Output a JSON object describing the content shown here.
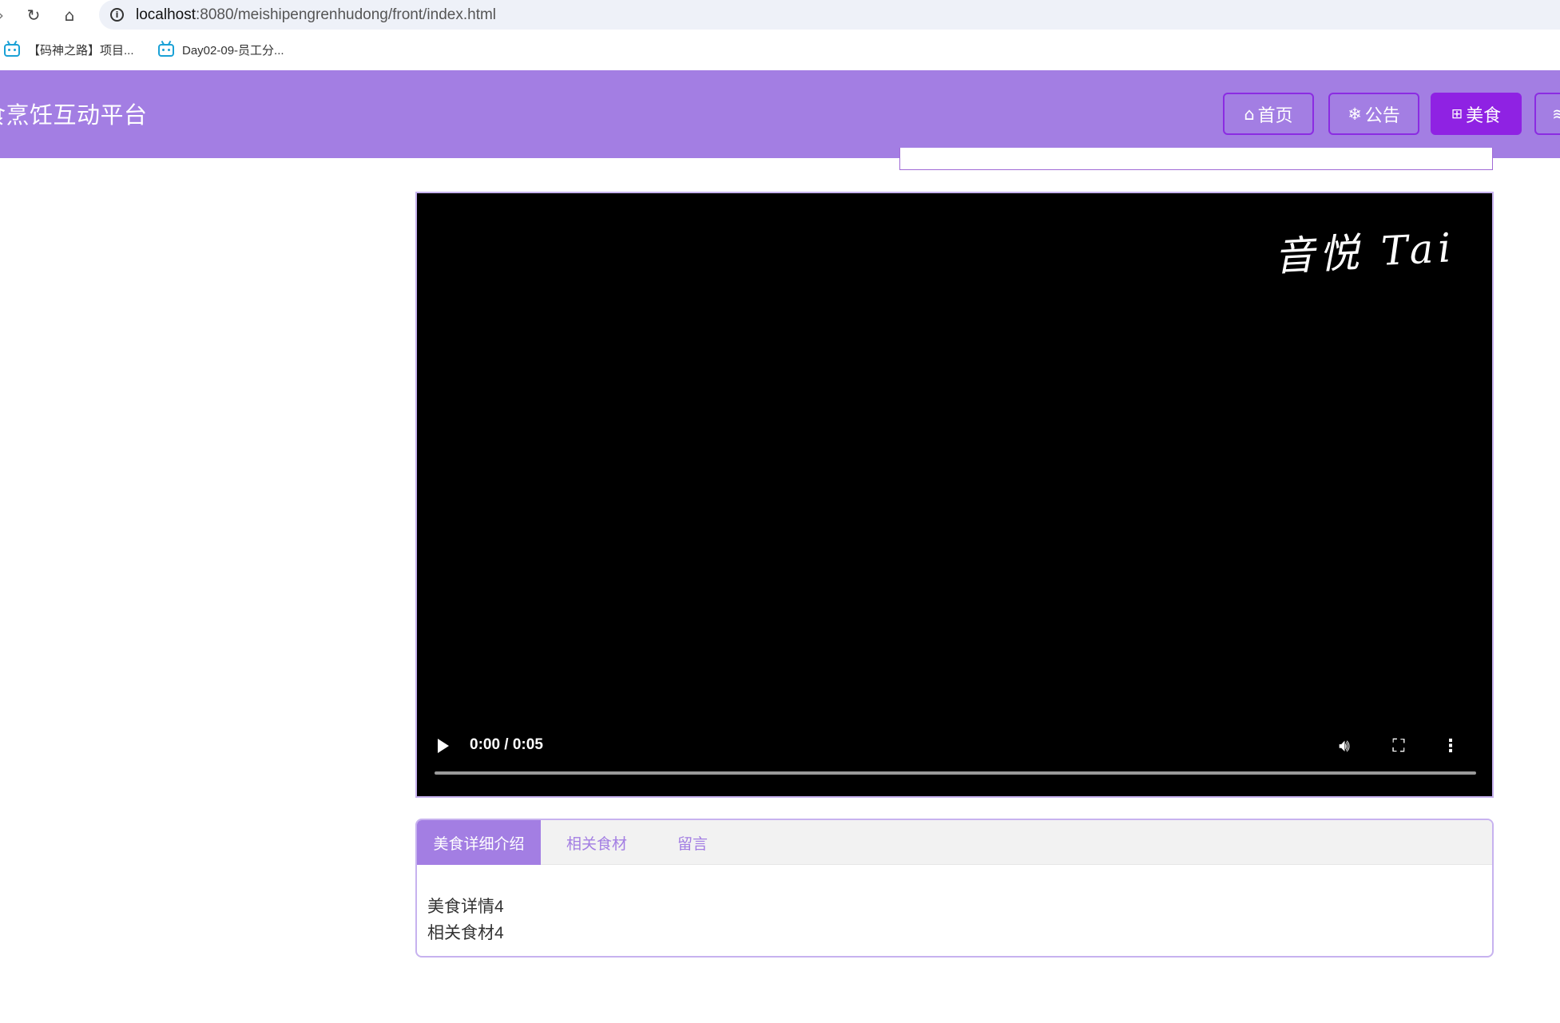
{
  "browser": {
    "url_host": "localhost",
    "url_path": ":8080/meishipengrenhudong/front/index.html",
    "bookmarks": [
      {
        "label": "【码神之路】项目..."
      },
      {
        "label": "Day02-09-员工分..."
      }
    ]
  },
  "header": {
    "title": "食烹饪互动平台",
    "nav": [
      {
        "label": "首页",
        "icon": "home-icon"
      },
      {
        "label": "公告",
        "icon": "snowflake-icon"
      },
      {
        "label": "美食",
        "icon": "gift-icon",
        "active": true
      },
      {
        "label": "",
        "icon": "layers-icon"
      }
    ]
  },
  "video": {
    "watermark": "音悦 Tai",
    "time": "0:00 / 0:05",
    "progress": 0
  },
  "tabs": {
    "items": [
      {
        "label": "美食详细介绍",
        "active": true
      },
      {
        "label": "相关食材"
      },
      {
        "label": "留言"
      }
    ],
    "content": {
      "line1": "美食详情4",
      "line2": "相关食材4"
    }
  },
  "colors": {
    "header_bg": "#a37ee3",
    "active_nav": "#8f22e3",
    "border": "#c7b2ef"
  }
}
